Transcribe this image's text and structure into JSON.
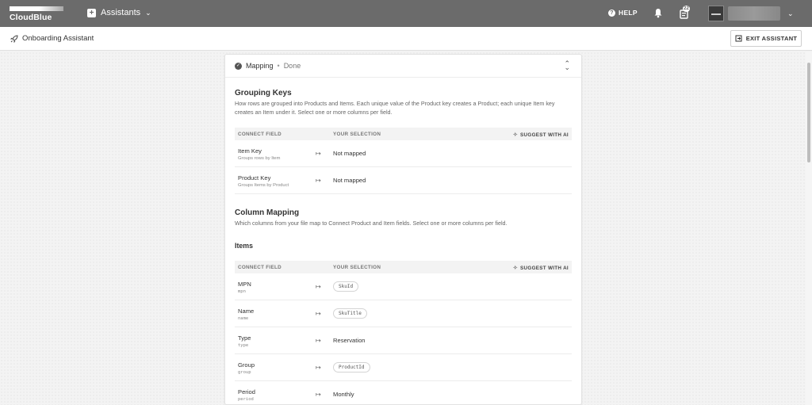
{
  "topbar": {
    "logo_text": "CloudBlue",
    "app_switcher_label": "Assistants",
    "help_label": "HELP",
    "tasks_badge": "22"
  },
  "subbar": {
    "title": "Onboarding Assistant",
    "exit_label": "EXIT ASSISTANT"
  },
  "card": {
    "step": "Mapping",
    "separator": "•",
    "state": "Done"
  },
  "grouping": {
    "title": "Grouping Keys",
    "description": "How rows are grouped into Products and Items. Each unique value of the Product key creates a Product; each unique Item key creates an Item under it. Select one or more columns per field.",
    "headers": {
      "field": "CONNECT FIELD",
      "selection": "YOUR SELECTION",
      "ai": "SUGGEST WITH AI"
    },
    "rows": [
      {
        "name": "Item Key",
        "sub": "Groups rows by Item",
        "value": "Not mapped"
      },
      {
        "name": "Product Key",
        "sub": "Groups Items by Product",
        "value": "Not mapped"
      }
    ]
  },
  "mapping": {
    "title": "Column Mapping",
    "description": "Which columns from your file map to Connect Product and Item fields. Select one or more columns per field.",
    "items_title": "Items",
    "headers": {
      "field": "CONNECT FIELD",
      "selection": "YOUR SELECTION",
      "ai": "SUGGEST WITH AI"
    },
    "rows": [
      {
        "name": "MPN",
        "sub": "mpn",
        "value": "SkuId"
      },
      {
        "name": "Name",
        "sub": "name",
        "value": "SkuTitle"
      },
      {
        "name": "Type",
        "sub": "type",
        "value": "Reservation"
      },
      {
        "name": "Group",
        "sub": "group",
        "value": "ProductId"
      },
      {
        "name": "Period",
        "sub": "period",
        "value": "Monthly"
      }
    ]
  },
  "arrow_glyph": "↦"
}
